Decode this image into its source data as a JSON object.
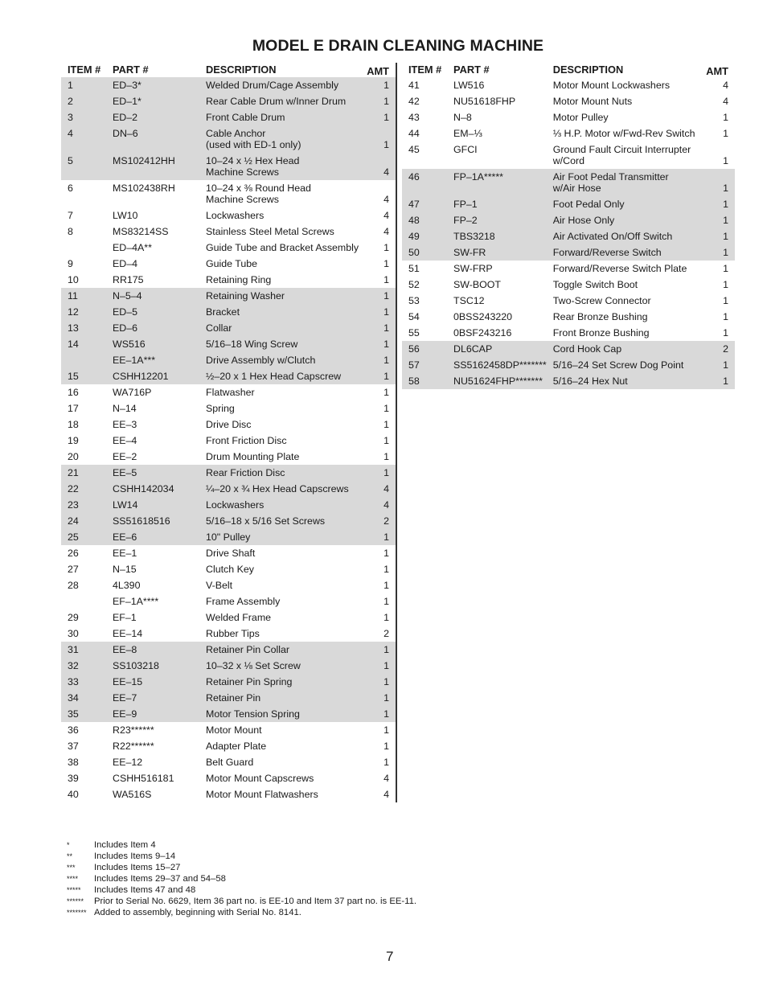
{
  "title": "MODEL E DRAIN CLEANING MACHINE",
  "headers": {
    "item": "ITEM #",
    "part": "PART #",
    "description": "DESCRIPTION",
    "amt": "AMT"
  },
  "left_rows": [
    {
      "item": "1",
      "part": "ED–3*",
      "desc": "Welded Drum/Cage Assembly",
      "amt": "1",
      "shaded": true
    },
    {
      "item": "2",
      "part": "ED–1*",
      "desc": "Rear Cable Drum w/Inner Drum",
      "amt": "1",
      "shaded": true
    },
    {
      "item": "3",
      "part": "ED–2",
      "desc": "Front Cable Drum",
      "amt": "1",
      "shaded": true
    },
    {
      "item": "4",
      "part": "DN–6",
      "desc": "Cable Anchor\n(used with ED-1 only)",
      "amt": "1",
      "shaded": true
    },
    {
      "item": "5",
      "part": "MS102412HH",
      "desc": "10–24 x ½ Hex Head\nMachine Screws",
      "amt": "4",
      "shaded": true
    },
    {
      "item": "6",
      "part": "MS102438RH",
      "desc": "10–24 x ⅜ Round Head\nMachine Screws",
      "amt": "4",
      "shaded": false
    },
    {
      "item": "7",
      "part": "LW10",
      "desc": "Lockwashers",
      "amt": "4",
      "shaded": false
    },
    {
      "item": "8",
      "part": "MS83214SS",
      "desc": "Stainless Steel Metal Screws",
      "amt": "4",
      "shaded": false
    },
    {
      "item": "",
      "part": "ED–4A**",
      "desc": "Guide Tube and Bracket Assembly",
      "amt": "1",
      "shaded": false
    },
    {
      "item": "9",
      "part": "ED–4",
      "desc": "Guide Tube",
      "amt": "1",
      "shaded": false
    },
    {
      "item": "10",
      "part": "RR175",
      "desc": "Retaining Ring",
      "amt": "1",
      "shaded": false
    },
    {
      "item": "11",
      "part": "N–5–4",
      "desc": "Retaining Washer",
      "amt": "1",
      "shaded": true
    },
    {
      "item": "12",
      "part": "ED–5",
      "desc": "Bracket",
      "amt": "1",
      "shaded": true
    },
    {
      "item": "13",
      "part": "ED–6",
      "desc": "Collar",
      "amt": "1",
      "shaded": true
    },
    {
      "item": "14",
      "part": "WS516",
      "desc": "5/16–18 Wing Screw",
      "amt": "1",
      "shaded": true
    },
    {
      "item": "",
      "part": "EE–1A***",
      "desc": "Drive Assembly w/Clutch",
      "amt": "1",
      "shaded": true
    },
    {
      "item": "15",
      "part": "CSHH12201",
      "desc": "½–20 x 1 Hex Head Capscrew",
      "amt": "1",
      "shaded": true
    },
    {
      "item": "16",
      "part": "WA716P",
      "desc": "Flatwasher",
      "amt": "1",
      "shaded": false
    },
    {
      "item": "17",
      "part": "N–14",
      "desc": "Spring",
      "amt": "1",
      "shaded": false
    },
    {
      "item": "18",
      "part": "EE–3",
      "desc": "Drive Disc",
      "amt": "1",
      "shaded": false
    },
    {
      "item": "19",
      "part": "EE–4",
      "desc": "Front Friction Disc",
      "amt": "1",
      "shaded": false
    },
    {
      "item": "20",
      "part": "EE–2",
      "desc": "Drum Mounting Plate",
      "amt": "1",
      "shaded": false
    },
    {
      "item": "21",
      "part": "EE–5",
      "desc": "Rear Friction Disc",
      "amt": "1",
      "shaded": true
    },
    {
      "item": "22",
      "part": "CSHH142034",
      "desc": "¼–20 x ¾ Hex Head Capscrews",
      "amt": "4",
      "shaded": true
    },
    {
      "item": "23",
      "part": "LW14",
      "desc": "Lockwashers",
      "amt": "4",
      "shaded": true
    },
    {
      "item": "24",
      "part": "SS51618516",
      "desc": "5/16–18 x 5/16 Set Screws",
      "amt": "2",
      "shaded": true
    },
    {
      "item": "25",
      "part": "EE–6",
      "desc": "10\" Pulley",
      "amt": "1",
      "shaded": true
    },
    {
      "item": "26",
      "part": "EE–1",
      "desc": "Drive Shaft",
      "amt": "1",
      "shaded": false
    },
    {
      "item": "27",
      "part": "N–15",
      "desc": "Clutch Key",
      "amt": "1",
      "shaded": false
    },
    {
      "item": "28",
      "part": "4L390",
      "desc": "V-Belt",
      "amt": "1",
      "shaded": false
    },
    {
      "item": "",
      "part": "EF–1A****",
      "desc": "Frame Assembly",
      "amt": "1",
      "shaded": false
    },
    {
      "item": "29",
      "part": "EF–1",
      "desc": "Welded Frame",
      "amt": "1",
      "shaded": false
    },
    {
      "item": "30",
      "part": "EE–14",
      "desc": "Rubber Tips",
      "amt": "2",
      "shaded": false
    },
    {
      "item": "31",
      "part": "EE–8",
      "desc": "Retainer Pin Collar",
      "amt": "1",
      "shaded": true
    },
    {
      "item": "32",
      "part": "SS103218",
      "desc": "10–32 x ⅛ Set Screw",
      "amt": "1",
      "shaded": true
    },
    {
      "item": "33",
      "part": "EE–15",
      "desc": "Retainer Pin Spring",
      "amt": "1",
      "shaded": true
    },
    {
      "item": "34",
      "part": "EE–7",
      "desc": "Retainer Pin",
      "amt": "1",
      "shaded": true
    },
    {
      "item": "35",
      "part": "EE–9",
      "desc": "Motor Tension Spring",
      "amt": "1",
      "shaded": true
    },
    {
      "item": "36",
      "part": "R23******",
      "desc": "Motor Mount",
      "amt": "1",
      "shaded": false
    },
    {
      "item": "37",
      "part": "R22******",
      "desc": "Adapter Plate",
      "amt": "1",
      "shaded": false
    },
    {
      "item": "38",
      "part": "EE–12",
      "desc": "Belt Guard",
      "amt": "1",
      "shaded": false
    },
    {
      "item": "39",
      "part": "CSHH516181",
      "desc": "Motor Mount Capscrews",
      "amt": "4",
      "shaded": false
    },
    {
      "item": "40",
      "part": "WA516S",
      "desc": "Motor Mount Flatwashers",
      "amt": "4",
      "shaded": false
    }
  ],
  "right_rows": [
    {
      "item": "41",
      "part": "LW516",
      "desc": "Motor Mount Lockwashers",
      "amt": "4",
      "shaded": false
    },
    {
      "item": "42",
      "part": "NU51618FHP",
      "desc": "Motor Mount Nuts",
      "amt": "4",
      "shaded": false
    },
    {
      "item": "43",
      "part": "N–8",
      "desc": "Motor Pulley",
      "amt": "1",
      "shaded": false
    },
    {
      "item": "44",
      "part": "EM–⅓",
      "desc": "⅓ H.P. Motor w/Fwd-Rev Switch",
      "amt": "1",
      "shaded": false
    },
    {
      "item": "45",
      "part": "GFCI",
      "desc": "Ground Fault Circuit Interrupter\nw/Cord",
      "amt": "1",
      "shaded": false
    },
    {
      "item": "46",
      "part": "FP–1A*****",
      "desc": "Air Foot Pedal Transmitter\nw/Air Hose",
      "amt": "1",
      "shaded": true
    },
    {
      "item": "47",
      "part": "FP–1",
      "desc": "Foot Pedal Only",
      "amt": "1",
      "shaded": true
    },
    {
      "item": "48",
      "part": "FP–2",
      "desc": "Air Hose Only",
      "amt": "1",
      "shaded": true
    },
    {
      "item": "49",
      "part": "TBS3218",
      "desc": "Air Activated On/Off Switch",
      "amt": "1",
      "shaded": true
    },
    {
      "item": "50",
      "part": "SW-FR",
      "desc": "Forward/Reverse Switch",
      "amt": "1",
      "shaded": true
    },
    {
      "item": "51",
      "part": "SW-FRP",
      "desc": "Forward/Reverse Switch Plate",
      "amt": "1",
      "shaded": false
    },
    {
      "item": "52",
      "part": "SW-BOOT",
      "desc": "Toggle Switch Boot",
      "amt": "1",
      "shaded": false
    },
    {
      "item": "53",
      "part": "TSC12",
      "desc": "Two-Screw Connector",
      "amt": "1",
      "shaded": false
    },
    {
      "item": "54",
      "part": "0BSS243220",
      "desc": "Rear Bronze Bushing",
      "amt": "1",
      "shaded": false
    },
    {
      "item": "55",
      "part": "0BSF243216",
      "desc": "Front Bronze Bushing",
      "amt": "1",
      "shaded": false
    },
    {
      "item": "56",
      "part": "DL6CAP",
      "desc": "Cord Hook Cap",
      "amt": "2",
      "shaded": true
    },
    {
      "item": "57",
      "part": "SS5162458DP*******",
      "desc": "5/16–24 Set Screw Dog Point",
      "amt": "1",
      "shaded": true
    },
    {
      "item": "58",
      "part": "NU51624FHP*******",
      "desc": "5/16–24 Hex Nut",
      "amt": "1",
      "shaded": true
    }
  ],
  "footnotes": [
    {
      "mark": "*",
      "text": "Includes Item 4"
    },
    {
      "mark": "**",
      "text": "Includes Items 9–14"
    },
    {
      "mark": "***",
      "text": "Includes Items 15–27"
    },
    {
      "mark": "****",
      "text": "Includes Items 29–37 and 54–58"
    },
    {
      "mark": "*****",
      "text": "Includes Items 47 and 48"
    },
    {
      "mark": "******",
      "text": "Prior to Serial No. 6629, Item 36 part no. is EE-10 and Item 37 part no. is EE-11."
    },
    {
      "mark": "*******",
      "text": "Added to assembly, beginning with Serial No. 8141."
    }
  ],
  "page_number": "7"
}
